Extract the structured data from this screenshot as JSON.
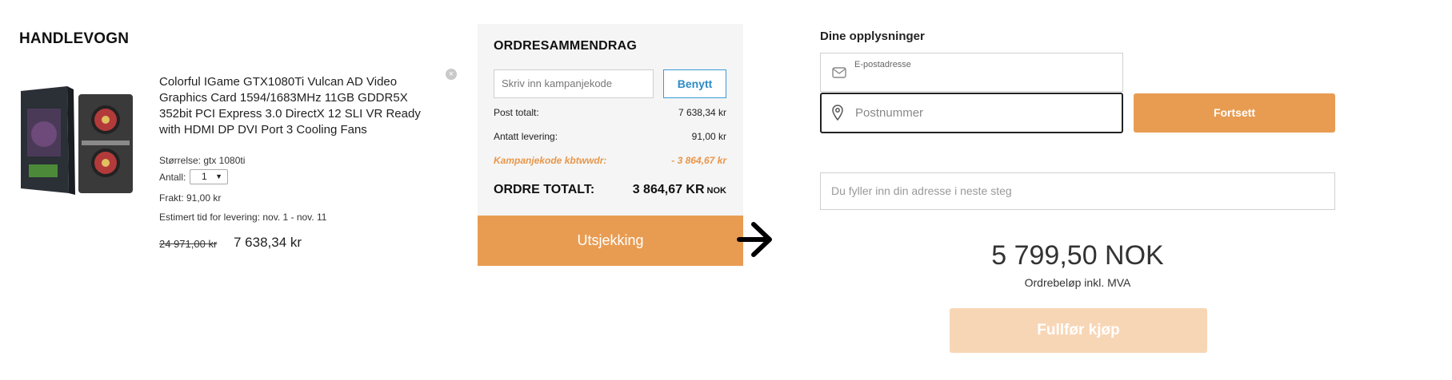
{
  "cart": {
    "title": "HANDLEVOGN",
    "product": {
      "name": "Colorful IGame GTX1080Ti Vulcan AD Video Graphics Card 1594/1683MHz 11GB GDDR5X 352bit PCI Express 3.0 DirectX 12 SLI VR Ready with HDMI DP DVI Port 3 Cooling Fans",
      "size": "Størrelse: gtx 1080ti",
      "qty_label": "Antall:",
      "qty_value": "1",
      "shipping": "Frakt: 91,00 kr",
      "delivery": "Estimert tid for levering: nov. 1 - nov. 11",
      "old_price": "24 971,00 kr",
      "new_price": "7 638,34 kr"
    }
  },
  "summary": {
    "title": "ORDRESAMMENDRAG",
    "promo_placeholder": "Skriv inn kampanjekode",
    "apply_label": "Benytt",
    "rows": [
      {
        "label": "Post totalt:",
        "value": "7 638,34 kr"
      },
      {
        "label": "Antatt levering:",
        "value": "91,00 kr"
      },
      {
        "label": "Kampanjekode kbtwwdr:",
        "value": "- 3 864,67 kr"
      }
    ],
    "total_label": "ORDRE TOTALT:",
    "total_value": "3 864,67 KR",
    "total_currency": "NOK",
    "checkout_label": "Utsjekking"
  },
  "details": {
    "title": "Dine opplysninger",
    "email_label": "E-postadresse",
    "zip_placeholder": "Postnummer",
    "continue_label": "Fortsett",
    "address_placeholder": "Du fyller inn din adresse i neste steg",
    "amount": "5 799,50 NOK",
    "amount_note": "Ordrebeløp inkl. MVA",
    "complete_label": "Fullfør kjøp"
  },
  "colors": {
    "accent": "#e89c52",
    "link_blue": "#2d8bc7",
    "disabled": "#f7d6b6"
  }
}
